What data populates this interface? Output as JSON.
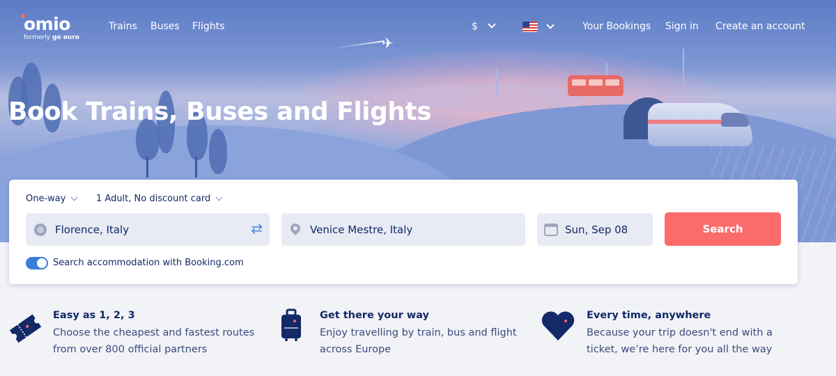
{
  "brand": {
    "name": "omio",
    "tagline_prefix": "formerly",
    "tagline_brand": "go euro"
  },
  "nav": {
    "links": [
      "Trains",
      "Buses",
      "Flights"
    ],
    "currency": "$",
    "language_flag": "us-flag-icon",
    "right_links": [
      "Your Bookings",
      "Sign in",
      "Create an account"
    ]
  },
  "hero": {
    "headline": "Book Trains, Buses and Flights"
  },
  "search": {
    "trip_type": "One-way",
    "passengers": "1 Adult, No discount card",
    "origin": "Florence, Italy",
    "destination": "Venice Mestre, Italy",
    "date": "Sun, Sep 08",
    "button": "Search",
    "accommodation_label": "Search accommodation with Booking.com",
    "accommodation_enabled": true
  },
  "features": [
    {
      "icon": "ticket-icon",
      "title": "Easy as 1, 2, 3",
      "lines": [
        "Choose the cheapest and fastest routes",
        "from over 800 official partners"
      ]
    },
    {
      "icon": "suitcase-icon",
      "title": "Get there your way",
      "lines": [
        "Enjoy travelling by train, bus and flight",
        "across Europe"
      ]
    },
    {
      "icon": "heart-icon",
      "title": "Every time, anywhere",
      "lines": [
        "Because your trip doesn't end with a",
        "ticket, we’re here for you all the way"
      ]
    }
  ],
  "colors": {
    "navy": "#132968",
    "coral": "#fb6b6b",
    "toggle": "#3b7ed9",
    "field": "#e8ebf3",
    "page": "#f2f3f7"
  }
}
